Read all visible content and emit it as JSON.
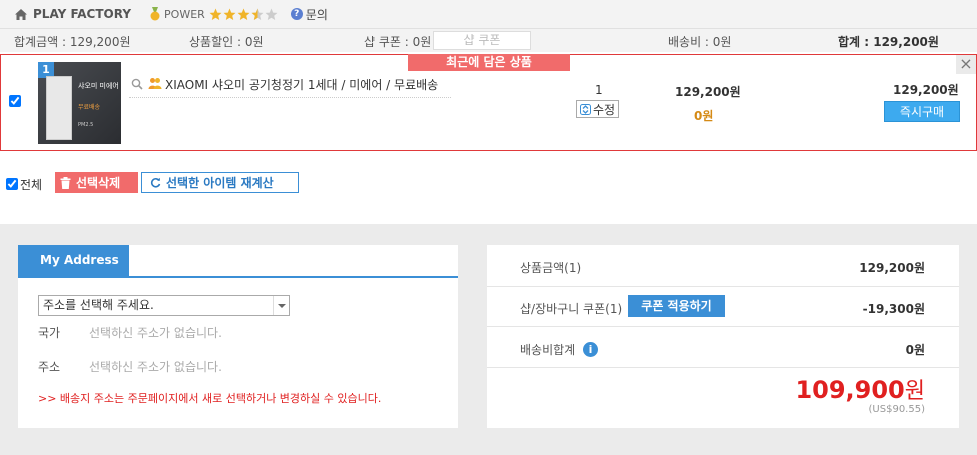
{
  "seller": {
    "name": "PLAY FACTORY",
    "power_label": "POWER",
    "rating_stars": 3.5,
    "rating_max": 5,
    "inquiry_label": "문의"
  },
  "summary": {
    "total_amount": "합계금액 : 129,200원",
    "product_discount": "상품할인 : 0원",
    "shop_coupon": "샵 쿠폰 : 0원",
    "shop_coupon_button": "샵 쿠폰",
    "shipping": "배송비 : 0원",
    "grand_total": "합계 : 129,200원"
  },
  "cart_item": {
    "banner": "최근에 담은 상품",
    "index": "1",
    "thumb_text_1": "샤오미 미에어",
    "thumb_text_2": "무료배송",
    "thumb_text_3": "PM2.5",
    "name": "XIAOMI 샤오미 공기청정기 1세대 / 미에어 / 무료배송",
    "quantity": "1",
    "edit_label": "수정",
    "price": "129,200원",
    "discount": "0원",
    "total": "129,200원",
    "buy_now_label": "즉시구매",
    "close_label": "×"
  },
  "actions": {
    "select_all_label": "전체",
    "delete_selected_label": "선택삭제",
    "recalc_label": "선택한 아이템 재계산"
  },
  "address": {
    "tab_label": "My Address",
    "select_placeholder": "주소를 선택해 주세요.",
    "country_label": "국가",
    "country_value": "선택하신 주소가 없습니다.",
    "address_label": "주소",
    "address_value": "선택하신 주소가 없습니다.",
    "note": ">> 배송지 주소는 주문페이지에서 새로 선택하거나 변경하실 수 있습니다."
  },
  "totals": {
    "product_amount_label": "상품금액(1)",
    "product_amount_value": "129,200원",
    "coupon_label": "샵/장바구니 쿠폰(1)",
    "apply_coupon_label": "쿠폰 적용하기",
    "coupon_value": "-19,300원",
    "shipping_label": "배송비합계",
    "shipping_value": "0원",
    "grand_total_number": "109,900",
    "grand_total_unit": "원",
    "usd_total": "(US$90.55)"
  },
  "colors": {
    "accent_blue": "#3b8fd6",
    "alert_red": "#e02020",
    "banner_red": "#f16b6b"
  }
}
